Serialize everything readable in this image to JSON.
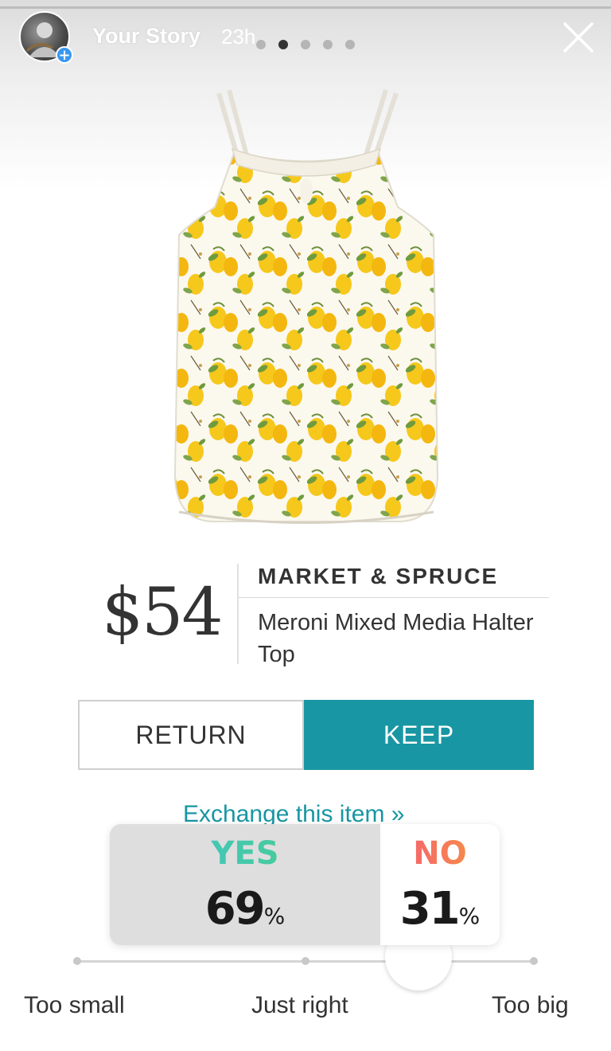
{
  "story": {
    "name": "Your Story",
    "time": "23h",
    "dots_total": 5,
    "dots_active_index": 1
  },
  "product": {
    "price": "$54",
    "brand": "MARKET & SPRUCE",
    "name": "Meroni Mixed Media Halter Top",
    "pattern": "lemon print"
  },
  "actions": {
    "return_label": "RETURN",
    "keep_label": "KEEP",
    "exchange_label": "Exchange this item »"
  },
  "poll": {
    "yes_label": "YES",
    "yes_value": "69",
    "no_label": "NO",
    "no_value": "31",
    "percent_sign": "%"
  },
  "slider": {
    "left_label": "Too small",
    "middle_label": "Just right",
    "right_label": "Too big",
    "value": 0.75
  },
  "colors": {
    "accent": "#1896a3",
    "yes_gradient": [
      "#3ec2d6",
      "#4cd07d"
    ],
    "no_gradient": [
      "#f4577a",
      "#f79a3b"
    ]
  },
  "icons": {
    "close": "close-icon",
    "add": "plus-icon"
  }
}
